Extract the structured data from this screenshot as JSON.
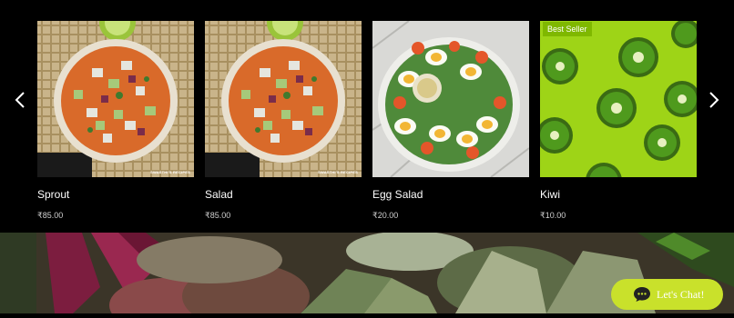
{
  "carousel": {
    "prev_icon": "chevron-left-icon",
    "next_icon": "chevron-right-icon",
    "products": [
      {
        "name": "Sprout",
        "price": "₹85.00",
        "ribbon": "",
        "watermark": "SWASTHI'S RECIPES"
      },
      {
        "name": "Salad",
        "price": "₹85.00",
        "ribbon": "",
        "watermark": "SWASTHI'S RECIPES"
      },
      {
        "name": "Egg Salad",
        "price": "₹20.00",
        "ribbon": "",
        "watermark": ""
      },
      {
        "name": "Kiwi",
        "price": "₹10.00",
        "ribbon": "Best Seller",
        "watermark": ""
      }
    ]
  },
  "chat": {
    "label": "Let's Chat!",
    "icon": "chat-bubble-icon",
    "color": "#c9e12b"
  },
  "colors": {
    "kiwi_background": "#9ed417",
    "ribbon": "#7fb800",
    "page_background": "#000000"
  }
}
